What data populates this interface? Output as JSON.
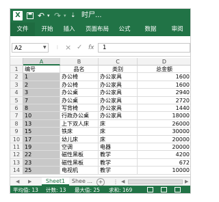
{
  "titlebar": {
    "logo": "X",
    "save_icon": "save-icon",
    "undo_icon": "↶",
    "redo_icon": "↷",
    "customize_icon": "⇣",
    "title": "时尸..."
  },
  "ribbon": {
    "tabs": [
      "文件",
      "开始",
      "插入",
      "页面布局",
      "公式",
      "数据",
      "审阅"
    ]
  },
  "formula_bar": {
    "name_box": "A2",
    "cancel": "×",
    "enter": "✓",
    "fx": "fx",
    "value": "1"
  },
  "columns": [
    "A",
    "B",
    "C",
    "D"
  ],
  "header_row": {
    "row_num": "1",
    "a": "编号",
    "b": "品名",
    "c": "类别",
    "d": "总金额"
  },
  "rows": [
    {
      "row_num": "2",
      "a": "1",
      "b": "办公椅",
      "c": "办公家具",
      "d": "1600"
    },
    {
      "row_num": "3",
      "a": "2",
      "b": "办公椅",
      "c": "办公家具",
      "d": "1600"
    },
    {
      "row_num": "4",
      "a": "3",
      "b": "办公桌",
      "c": "办公家具",
      "d": "2940"
    },
    {
      "row_num": "5",
      "a": "7",
      "b": "办公桌",
      "c": "办公家具",
      "d": "2720"
    },
    {
      "row_num": "6",
      "a": "8",
      "b": "写背椅",
      "c": "办公家具",
      "d": "1440"
    },
    {
      "row_num": "7",
      "a": "10",
      "b": "行政办公桌",
      "c": "办公家具",
      "d": "18000"
    },
    {
      "row_num": "8",
      "a": "13",
      "b": "上下双人床",
      "c": "床",
      "d": "26000"
    },
    {
      "row_num": "9",
      "a": "15",
      "b": "铁床",
      "c": "床",
      "d": "30000"
    },
    {
      "row_num": "10",
      "a": "17",
      "b": "幼儿床",
      "c": "床",
      "d": "20000"
    },
    {
      "row_num": "11",
      "a": "19",
      "b": "空调",
      "c": "电器",
      "d": "20000"
    },
    {
      "row_num": "12",
      "a": "22",
      "b": "磁性黑板",
      "c": "教学",
      "d": "4200"
    },
    {
      "row_num": "13",
      "a": "23",
      "b": "磁性黑板",
      "c": "教学",
      "d": "672"
    },
    {
      "row_num": "14",
      "a": "25",
      "b": "电视机",
      "c": "教学",
      "d": "10000"
    }
  ],
  "sheet_tabs": {
    "prev": "◀",
    "next": "▶",
    "active": "Sheet1",
    "inactive": "Shee ...",
    "add": "+"
  },
  "status": {
    "average": "平均值: 13",
    "count": "计数: 13",
    "max": "最大值: 25",
    "sum": "求和: 169"
  },
  "colors": {
    "excel_green": "#217346",
    "selected_column": "#c8c8c8"
  }
}
